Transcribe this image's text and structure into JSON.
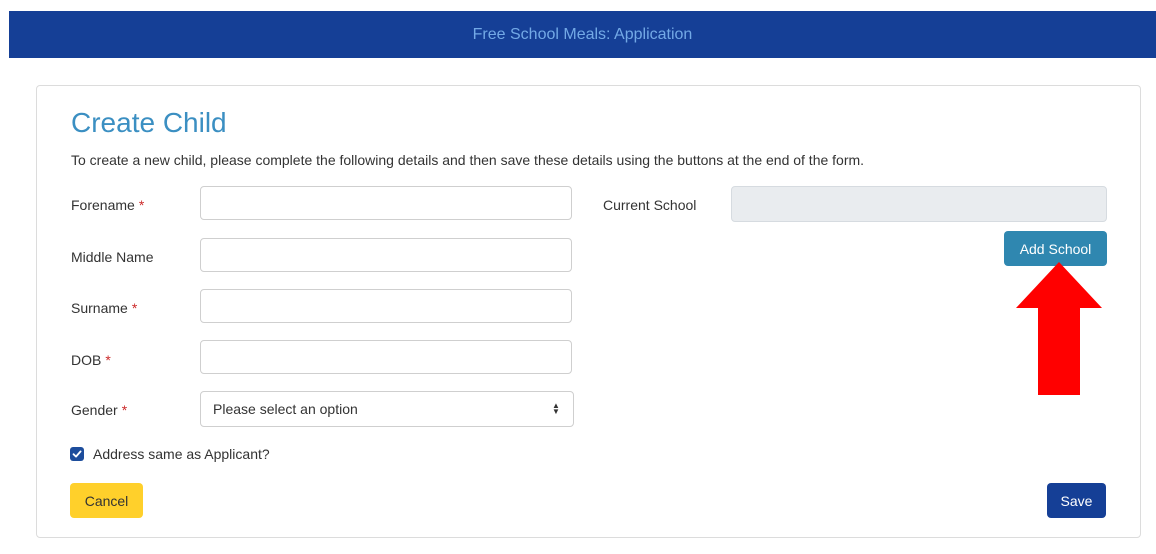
{
  "header": {
    "title": "Free School Meals: Application"
  },
  "form": {
    "title": "Create Child",
    "intro": "To create a new child, please complete the following details and then save these details using the buttons at the end of the form.",
    "required_marker": "*",
    "fields": {
      "forename": {
        "label": "Forename",
        "value": ""
      },
      "middle_name": {
        "label": "Middle Name",
        "value": ""
      },
      "surname": {
        "label": "Surname",
        "value": ""
      },
      "dob": {
        "label": "DOB",
        "value": ""
      },
      "gender": {
        "label": "Gender",
        "selected": "Please select an option"
      }
    },
    "current_school": {
      "label": "Current School",
      "value": ""
    },
    "add_school_label": "Add School",
    "address_same": {
      "label": "Address same as Applicant?",
      "checked": true
    },
    "cancel_label": "Cancel",
    "save_label": "Save"
  },
  "annotation": {
    "icon": "arrow-up-icon",
    "color": "#ff0000"
  },
  "colors": {
    "header_bg": "#153f96",
    "header_text": "#73a9e6",
    "title": "#3b8fc2",
    "add_school_bg": "#2f87b0",
    "cancel_bg": "#ffd02b",
    "save_bg": "#153f96",
    "checkbox": "#1d4d9c",
    "required": "#cc2a2a"
  }
}
